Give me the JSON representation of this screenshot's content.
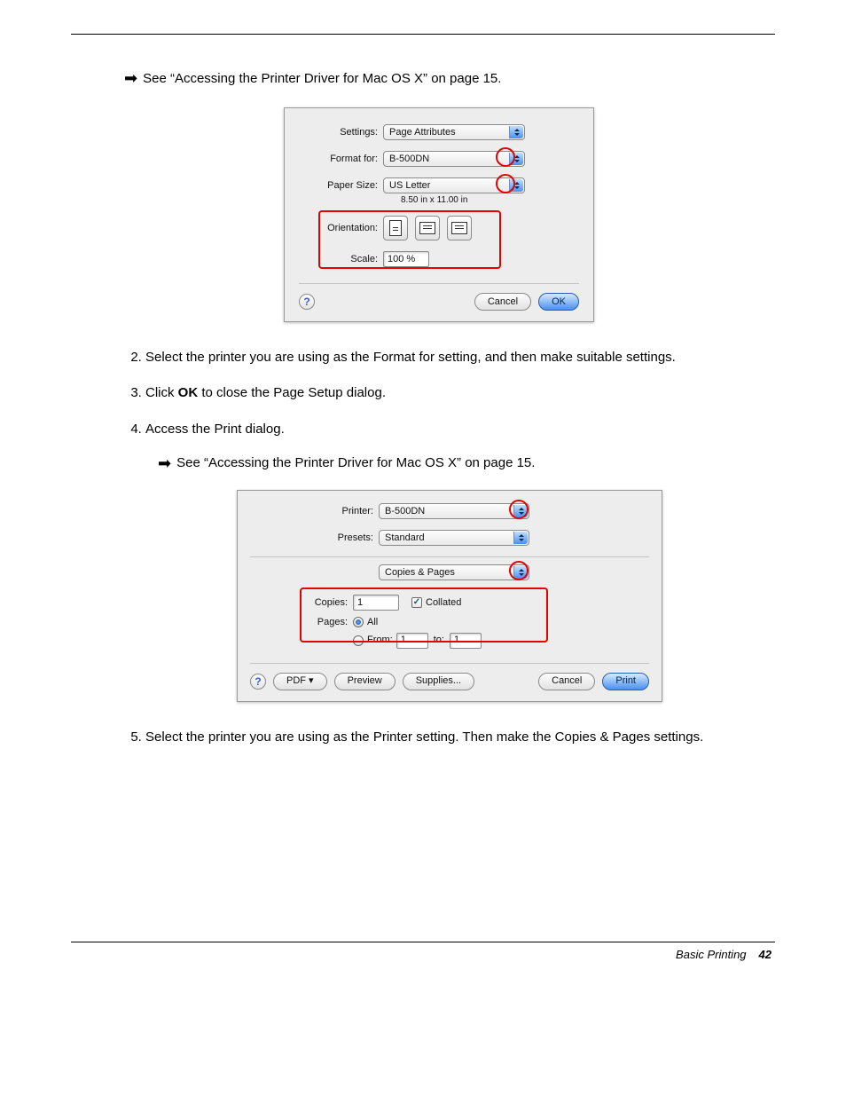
{
  "xref1": "See “Accessing the Printer Driver for Mac OS X” on page 15.",
  "arrow_glyph": "➡",
  "page_setup": {
    "labels": {
      "settings": "Settings:",
      "format_for": "Format for:",
      "paper_size": "Paper Size:",
      "orientation": "Orientation:",
      "scale": "Scale:"
    },
    "settings_value": "Page Attributes",
    "format_for_value": "B-500DN",
    "paper_size_value": "US Letter",
    "paper_dimensions": "8.50 in x 11.00 in",
    "scale_value": "100 %",
    "cancel": "Cancel",
    "ok": "OK",
    "help": "?"
  },
  "steps": {
    "s2": "Select the printer you are using as the Format for setting, and then make suitable settings.",
    "s3_a": "Click ",
    "s3_b": "OK",
    "s3_c": " to close the Page Setup dialog.",
    "s4": "Access the Print dialog.",
    "s5": "Select the printer you are using as the Printer setting. Then make the Copies & Pages settings."
  },
  "xref2": "See “Accessing the Printer Driver for Mac OS X” on page 15.",
  "print_dialog": {
    "labels": {
      "printer": "Printer:",
      "presets": "Presets:",
      "copies": "Copies:",
      "pages": "Pages:",
      "from": "From:",
      "to": "to:"
    },
    "printer_value": "B-500DN",
    "presets_value": "Standard",
    "panel_value": "Copies & Pages",
    "copies_value": "1",
    "collated_label": "Collated",
    "all_label": "All",
    "from_value": "1",
    "to_value": "1",
    "help": "?",
    "pdf": "PDF ▾",
    "preview": "Preview",
    "supplies": "Supplies...",
    "cancel": "Cancel",
    "print": "Print"
  },
  "footer": {
    "section": "Basic Printing",
    "page": "42"
  }
}
